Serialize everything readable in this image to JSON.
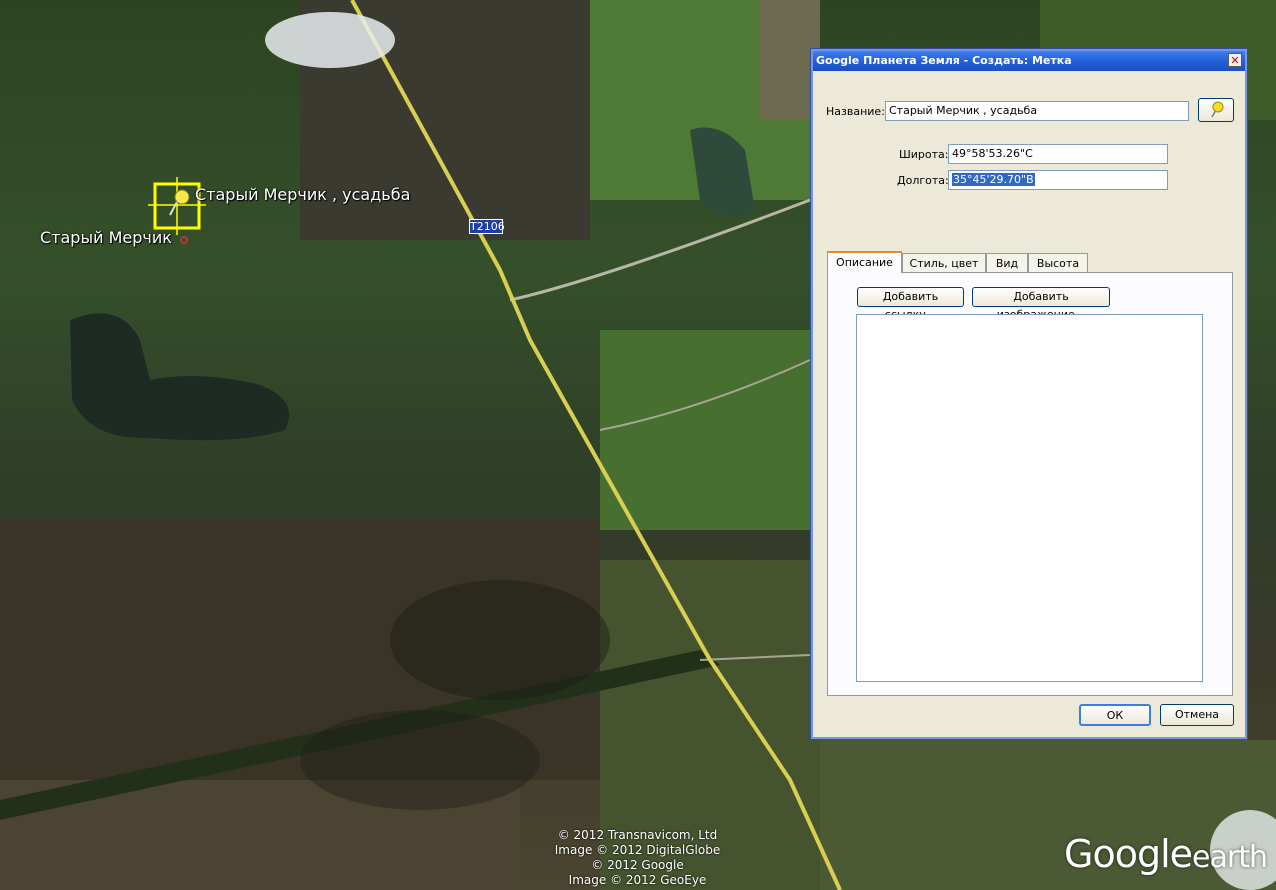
{
  "map": {
    "placemark_label": "Старый Мерчик , усадьба",
    "village_label": "Старый Мерчик",
    "road_number": "T2106",
    "attribution": [
      "© 2012 Transnavicom, Ltd",
      "Image © 2012 DigitalGlobe",
      "© 2012 Google",
      "Image © 2012 GeoEye"
    ],
    "logo_main": "Google",
    "logo_small": "earth",
    "colors": {
      "road": "#d8cf52",
      "placemark": "#ffff00"
    }
  },
  "dialog": {
    "title": "Google Планета Земля - Создать: Метка",
    "close_glyph": "✕",
    "name_label": "Название:",
    "name_value": "Старый Мерчик , усадьба",
    "pin_icon": "pushpin-icon",
    "latitude_label": "Широта:",
    "latitude_value": "49°58'53.26\"С",
    "longitude_label": "Долгота:",
    "longitude_value": "35°45'29.70\"В",
    "tabs": [
      "Описание",
      "Стиль, цвет",
      "Вид",
      "Высота"
    ],
    "active_tab": "Описание",
    "add_link_label": "Добавить ссылку...",
    "add_image_label": "Добавить изображение...",
    "description_value": "",
    "ok_label": "ОК",
    "cancel_label": "Отмена"
  }
}
